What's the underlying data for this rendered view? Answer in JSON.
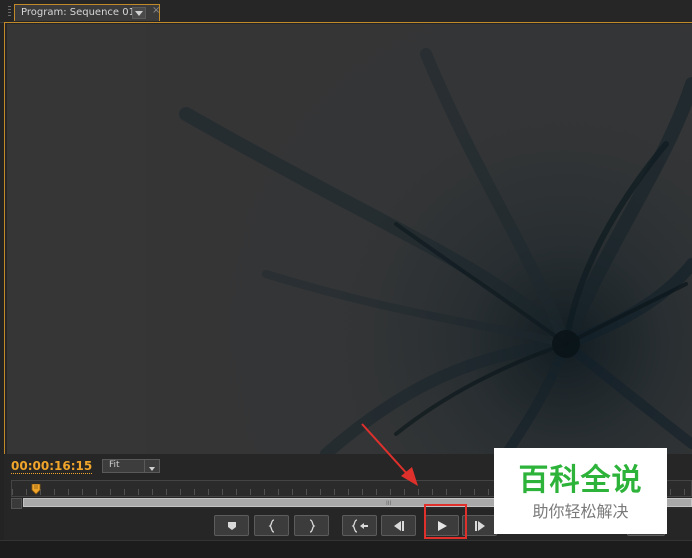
{
  "panel": {
    "tab_label": "Program: Sequence 01",
    "close_glyph": "×"
  },
  "monitor": {
    "timecode": "00:00:16:15",
    "zoom_select": "Fit",
    "scroll_grip": "III"
  },
  "transport": {
    "buttons": [
      {
        "name": "add-marker-button",
        "icon": "marker-icon"
      },
      {
        "name": "mark-in-button",
        "icon": "mark-in-icon"
      },
      {
        "name": "mark-out-button",
        "icon": "mark-out-icon"
      },
      {
        "name": "go-to-in-button",
        "icon": "go-to-in-icon"
      },
      {
        "name": "step-back-button",
        "icon": "step-back-icon"
      },
      {
        "name": "play-button",
        "icon": "play-icon"
      },
      {
        "name": "step-forward-button",
        "icon": "step-forward-icon"
      }
    ]
  },
  "watermark": {
    "title": "百科全说",
    "subtitle": "助你轻松解决"
  },
  "colors": {
    "accent": "#f0a52a",
    "panel_border": "#c08a2a",
    "highlight": "#e0302c",
    "watermark_green": "#2db33a"
  }
}
